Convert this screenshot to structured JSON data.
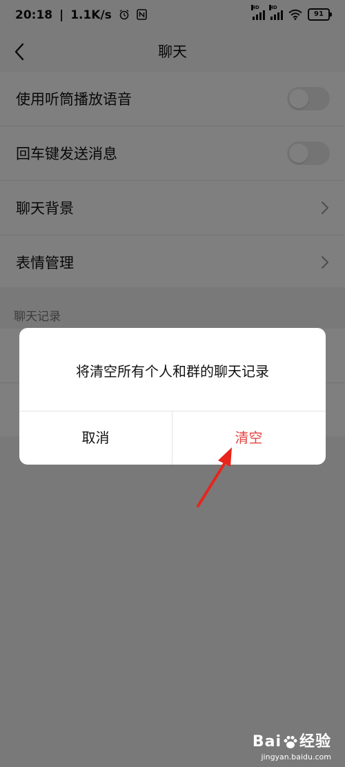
{
  "status_bar": {
    "time": "20:18",
    "network_speed": "1.1K/s",
    "battery_level": "91",
    "signal_label": "HD",
    "icons": [
      "alarm-icon",
      "nfc-icon",
      "signal-icon",
      "wifi-icon",
      "battery-icon"
    ]
  },
  "nav": {
    "title": "聊天",
    "back_icon": "chevron-left-icon"
  },
  "settings": {
    "items": [
      {
        "label": "使用听筒播放语音",
        "type": "toggle",
        "enabled": false
      },
      {
        "label": "回车键发送消息",
        "type": "toggle",
        "enabled": false
      },
      {
        "label": "聊天背景",
        "type": "link"
      },
      {
        "label": "表情管理",
        "type": "link"
      }
    ]
  },
  "chat_history": {
    "section_title": "聊天记录"
  },
  "dialog": {
    "message": "将清空所有个人和群的聊天记录",
    "cancel_label": "取消",
    "confirm_label": "清空"
  },
  "watermark": {
    "logo_text_prefix": "Bai",
    "logo_text_suffix": "经验",
    "url": "jingyan.baidu.com"
  },
  "colors": {
    "confirm": "#e64340",
    "annotation_arrow": "#e8241c",
    "overlay": "rgba(0,0,0,0.5)"
  }
}
